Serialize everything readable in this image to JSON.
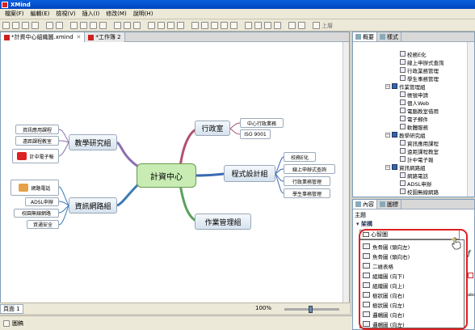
{
  "app": {
    "title": "XMind"
  },
  "menu": {
    "items": [
      "檔案(F)",
      "編輯(E)",
      "檢視(V)",
      "插入(I)",
      "修改(M)",
      "說明(H)"
    ]
  },
  "toolbar": {
    "up_label": "上層"
  },
  "editor": {
    "tabs": [
      {
        "label": "*計資中心組織圖.xmind",
        "active": true
      },
      {
        "label": "*工作簿 2",
        "active": false
      }
    ],
    "sheet_tab": "頁面 1",
    "zoom": "100%"
  },
  "mindmap": {
    "central": "計資中心",
    "branches": {
      "office": {
        "label": "行政室",
        "children": [
          "中心行政業務",
          "ISO 9001"
        ]
      },
      "programming": {
        "label": "程式設計組",
        "children": [
          "校務E化",
          "線上申辦式查詢",
          "行政業務管理",
          "學生事務管理"
        ]
      },
      "operations": {
        "label": "作業管理組"
      },
      "research": {
        "label": "教學研究組",
        "children": [
          "資訊應用課程",
          "遠距課程教室",
          "計中電子報"
        ]
      },
      "network": {
        "label": "資訊網路組",
        "children": [
          "網路電話",
          "ADSL申辦",
          "校園無線網路",
          "資通安全"
        ]
      }
    }
  },
  "outline": {
    "tabs": [
      {
        "label": "概要",
        "active": true
      },
      {
        "label": "樣式",
        "active": false
      }
    ],
    "rows": [
      {
        "label": "校務E化",
        "indent": 2,
        "kind": "t"
      },
      {
        "label": "線上申辦式查詢",
        "indent": 2,
        "kind": "t"
      },
      {
        "label": "行政業務管理",
        "indent": 2,
        "kind": "t"
      },
      {
        "label": "學生事務管理",
        "indent": 2,
        "kind": "t"
      },
      {
        "label": "作業管理組",
        "indent": 1,
        "kind": "m"
      },
      {
        "label": "帳號申請",
        "indent": 2,
        "kind": "t"
      },
      {
        "label": "個人Web",
        "indent": 2,
        "kind": "t"
      },
      {
        "label": "電腦教室借用",
        "indent": 2,
        "kind": "t"
      },
      {
        "label": "電子郵件",
        "indent": 2,
        "kind": "t"
      },
      {
        "label": "軟體服務",
        "indent": 2,
        "kind": "t"
      },
      {
        "label": "教學研究組",
        "indent": 1,
        "kind": "m"
      },
      {
        "label": "資訊應用課程",
        "indent": 2,
        "kind": "t"
      },
      {
        "label": "遠距課程教室",
        "indent": 2,
        "kind": "t"
      },
      {
        "label": "計中電子報",
        "indent": 2,
        "kind": "t"
      },
      {
        "label": "資訊網路組",
        "indent": 1,
        "kind": "m"
      },
      {
        "label": "網路電話",
        "indent": 2,
        "kind": "t"
      },
      {
        "label": "ADSL申辦",
        "indent": 2,
        "kind": "t"
      },
      {
        "label": "校園無線網路",
        "indent": 2,
        "kind": "t"
      }
    ]
  },
  "properties": {
    "tabs": [
      {
        "label": "內容",
        "active": true
      },
      {
        "label": "圖標",
        "active": false
      }
    ],
    "subheading": "主題",
    "section": "架構",
    "selected_structure": "心智圖",
    "structure_options": [
      "魚骨圖 (頭向左)",
      "魚骨圖 (頭向右)",
      "二維表格",
      "組織圖 (向下)",
      "組織圖 (向上)",
      "樹狀圖 (向右)",
      "樹狀圖 (向左)",
      "邏輯圖 (向右)",
      "邏輯圖 (向左)"
    ]
  },
  "bottom_panel": {
    "label": "圖稿"
  },
  "colors": {
    "central_fill": "#c8ecb4",
    "highlight_ring": "#e02020",
    "branch_office": "#b05070",
    "branch_programming": "#3a6ab4",
    "branch_operations": "#5aa05a",
    "branch_research": "#8a70b0",
    "branch_network": "#3a7ab4"
  }
}
